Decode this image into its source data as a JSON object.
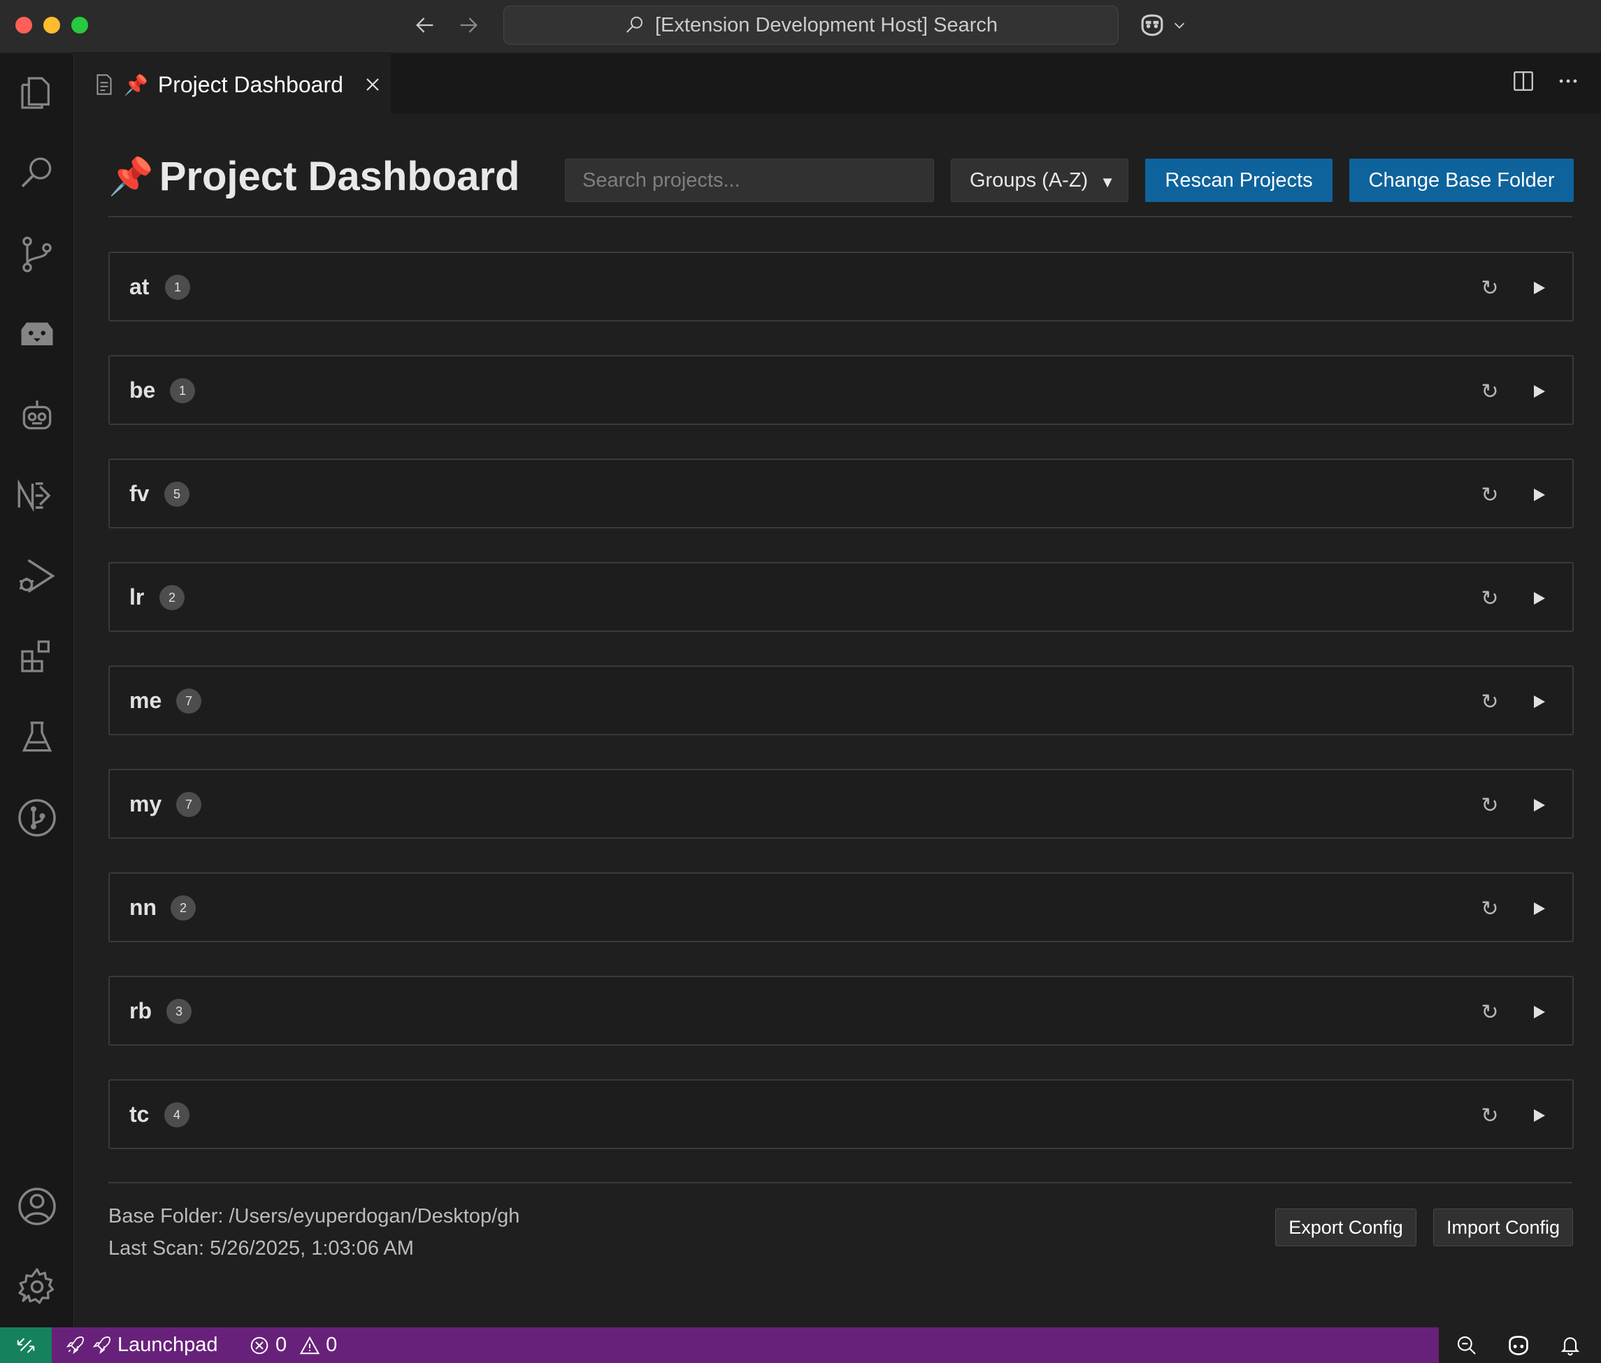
{
  "window": {
    "command_center": "[Extension Development Host] Search"
  },
  "tab": {
    "emoji": "📌",
    "title": "Project Dashboard"
  },
  "dashboard": {
    "emoji": "📌",
    "title": "Project Dashboard",
    "search_placeholder": "Search projects...",
    "sort_selected": "Groups (A-Z)",
    "rescan_label": "Rescan Projects",
    "change_folder_label": "Change Base Folder"
  },
  "groups": [
    {
      "name": "at",
      "count": "1"
    },
    {
      "name": "be",
      "count": "1"
    },
    {
      "name": "fv",
      "count": "5"
    },
    {
      "name": "lr",
      "count": "2"
    },
    {
      "name": "me",
      "count": "7"
    },
    {
      "name": "my",
      "count": "7"
    },
    {
      "name": "nn",
      "count": "2"
    },
    {
      "name": "rb",
      "count": "3"
    },
    {
      "name": "tc",
      "count": "4"
    }
  ],
  "footer": {
    "base_folder": "Base Folder: /Users/eyuperdogan/Desktop/gh",
    "last_scan": "Last Scan: 5/26/2025, 1:03:06 AM",
    "export_label": "Export Config",
    "import_label": "Import Config"
  },
  "statusbar": {
    "launchpad": "Launchpad",
    "errors": "0",
    "warnings": "0"
  },
  "icons": {
    "refresh": "↻"
  },
  "colors": {
    "accent_button": "#0e639c",
    "statusbar": "#68217a",
    "remote": "#16825d"
  }
}
